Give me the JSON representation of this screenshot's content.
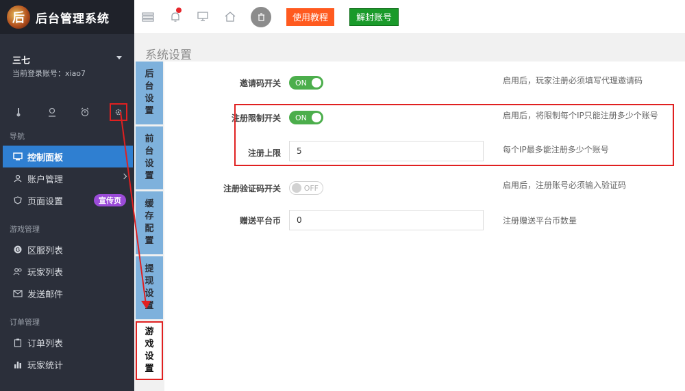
{
  "app": {
    "title": "后台管理系统",
    "logo_text": "后"
  },
  "user": {
    "name": "三七",
    "account_label": "当前登录账号：xiao7"
  },
  "quick_icons": [
    "thermometer-icon",
    "location-icon",
    "alarm-icon",
    "gear-icon"
  ],
  "sidebar": {
    "section_nav": "导航",
    "items_nav": [
      {
        "label": "控制面板",
        "icon": "monitor-icon",
        "active": true
      },
      {
        "label": "账户管理",
        "icon": "user-icon"
      },
      {
        "label": "页面设置",
        "icon": "shield-icon",
        "badge": "宣传页"
      }
    ],
    "section_game": "游戏管理",
    "items_game": [
      {
        "label": "区服列表",
        "icon": "g-icon"
      },
      {
        "label": "玩家列表",
        "icon": "users-icon"
      },
      {
        "label": "发送邮件",
        "icon": "mail-icon"
      }
    ],
    "section_order": "订单管理",
    "items_order": [
      {
        "label": "订单列表",
        "icon": "clipboard-icon"
      },
      {
        "label": "玩家统计",
        "icon": "bar-chart-icon"
      }
    ]
  },
  "topbar": {
    "tutorial_button": "使用教程",
    "unban_button": "解封账号"
  },
  "page_title": "系统设置",
  "tabs": [
    {
      "label": "后台设置"
    },
    {
      "label": "前台设置"
    },
    {
      "label": "缓存配置"
    },
    {
      "label": "提现设置"
    },
    {
      "label": "游戏设置",
      "active": true
    }
  ],
  "settings": {
    "invite_code": {
      "label": "邀请码开关",
      "toggle": "ON",
      "hint": "启用后，玩家注册必须填写代理邀请码"
    },
    "register_limit": {
      "label": "注册限制开关",
      "toggle": "ON",
      "hint": "启用后，将限制每个IP只能注册多少个账号"
    },
    "register_max": {
      "label": "注册上限",
      "value": "5",
      "hint": "每个IP最多能注册多少个账号"
    },
    "captcha": {
      "label": "注册验证码开关",
      "toggle": "OFF",
      "hint": "启用后，注册账号必须输入验证码"
    },
    "bonus_coins": {
      "label": "赠送平台币",
      "value": "0",
      "hint": "注册赠送平台币数量"
    }
  },
  "colors": {
    "accent": "#2f7fd1",
    "highlight": "#e02020",
    "toggle_on": "#4cae4c"
  }
}
